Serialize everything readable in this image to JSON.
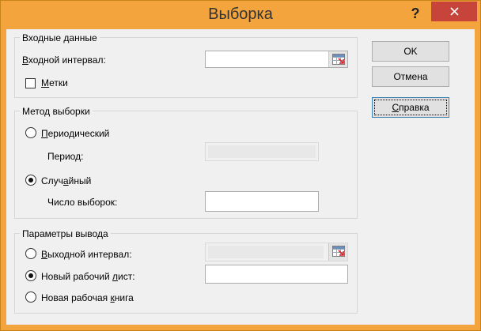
{
  "window": {
    "title": "Выборка",
    "help_glyph": "?",
    "accent_color": "#f4a43c",
    "close_color": "#c7443b"
  },
  "input_group": {
    "legend": "Входные данные",
    "input_range_label_u": "В",
    "input_range_label_rest": "ходной интервал:",
    "input_range_value": "",
    "labels_checkbox_u": "М",
    "labels_checkbox_rest": "етки",
    "labels_checked": false
  },
  "method_group": {
    "legend": "Метод выборки",
    "periodic_u": "П",
    "periodic_rest": "ериодический",
    "periodic_selected": false,
    "period_label": "Период:",
    "period_value": "",
    "random_pre": "Случ",
    "random_u": "а",
    "random_post": "йный",
    "random_selected": true,
    "sample_count_label": "Число выборок:",
    "sample_count_value": ""
  },
  "output_group": {
    "legend": "Параметры вывода",
    "output_range_u": "В",
    "output_range_rest": "ыходной интервал:",
    "output_range_selected": false,
    "output_range_value": "",
    "new_sheet_pre": "Новый рабочий ",
    "new_sheet_u": "л",
    "new_sheet_post": "ист:",
    "new_sheet_selected": true,
    "new_sheet_value": "",
    "new_book_pre": "Новая рабочая ",
    "new_book_u": "к",
    "new_book_post": "нига",
    "new_book_selected": false
  },
  "buttons": {
    "ok": "OK",
    "cancel": "Отмена",
    "help_u": "С",
    "help_rest": "правка"
  },
  "icons": {
    "collapse_dialog": "range-select-icon",
    "close": "close-icon"
  }
}
